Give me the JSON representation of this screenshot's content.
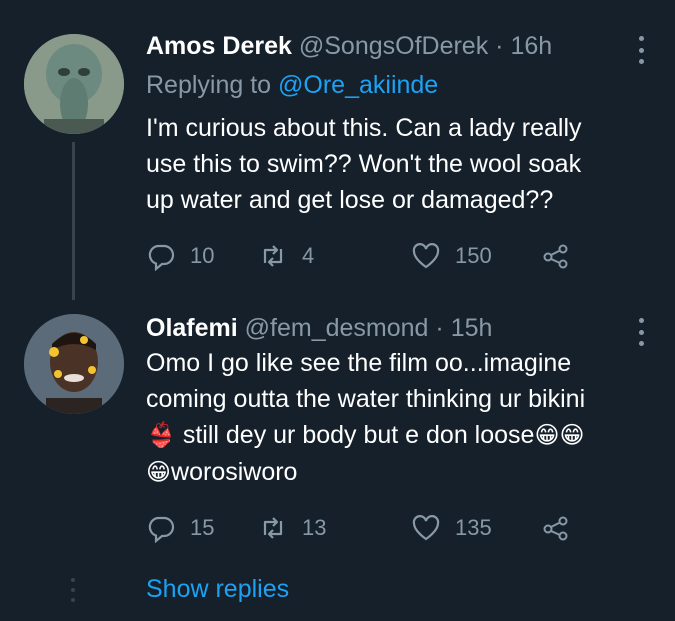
{
  "tweets": [
    {
      "name": "Amos Derek",
      "handle": "@SongsOfDerek",
      "separator": "·",
      "time": "16h",
      "replying_label": "Replying to",
      "replying_handle": "@Ore_akiinde",
      "lines": [
        "I'm curious about this. Can a lady really",
        "use this to swim?? Won't the wool soak",
        "up water and get lose or damaged??"
      ],
      "replies": "10",
      "retweets": "4",
      "likes": "150"
    },
    {
      "name": "Olafemi",
      "handle": "@fem_desmond",
      "separator": "·",
      "time": "15h",
      "lines": [
        "Omo I go like see the film oo...imagine",
        "coming outta the water thinking ur bikini"
      ],
      "line3_emoji": "👙",
      "line3_text": " still dey ur body but e don loose",
      "line3_emoji_end": "😁😁",
      "line4_emoji": "😁",
      "line4_text": "worosiworo",
      "replies": "15",
      "retweets": "13",
      "likes": "135"
    }
  ],
  "show_replies": "Show replies",
  "icons": [
    "reply-icon",
    "retweet-icon",
    "like-icon",
    "share-icon",
    "more-icon"
  ],
  "colors": {
    "background": "#15202b",
    "secondary": "#8899a6",
    "accent": "#1da1f2"
  }
}
